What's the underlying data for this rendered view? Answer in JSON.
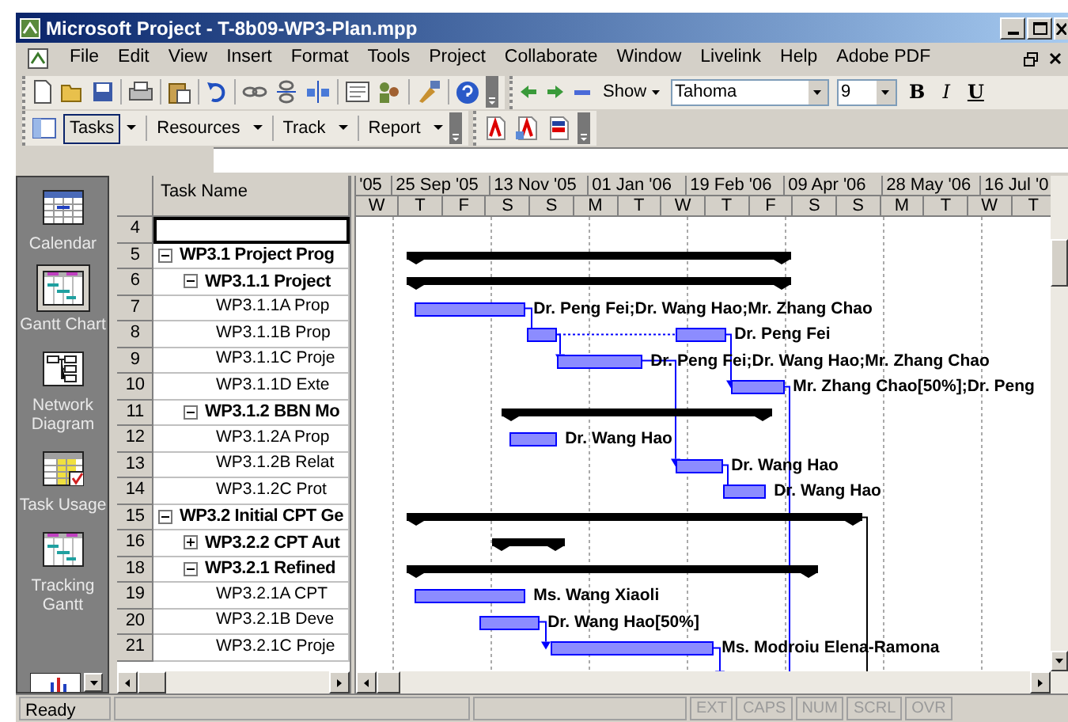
{
  "window": {
    "title": "Microsoft Project - T-8b09-WP3-Plan.mpp"
  },
  "menu": [
    "File",
    "Edit",
    "View",
    "Insert",
    "Format",
    "Tools",
    "Project",
    "Collaborate",
    "Window",
    "Livelink",
    "Help",
    "Adobe PDF"
  ],
  "formatting": {
    "show_label": "Show",
    "font": "Tahoma",
    "size": "9",
    "bold": "B",
    "italic": "I",
    "underline": "U"
  },
  "guide_toolbar": [
    {
      "label": "Tasks",
      "selected": true
    },
    {
      "label": "Resources",
      "selected": false
    },
    {
      "label": "Track",
      "selected": false
    },
    {
      "label": "Report",
      "selected": false
    }
  ],
  "view_bar": [
    {
      "label": "Calendar",
      "kind": "calendar",
      "selected": false
    },
    {
      "label": "Gantt Chart",
      "kind": "gantt",
      "selected": true
    },
    {
      "label": "Network Diagram",
      "kind": "network",
      "selected": false
    },
    {
      "label": "Task Usage",
      "kind": "usage",
      "selected": false
    },
    {
      "label": "Tracking Gantt",
      "kind": "gantt",
      "selected": false
    }
  ],
  "table": {
    "column": "Task Name"
  },
  "tasks": [
    {
      "id": "4",
      "kind": "blank",
      "selected": true
    },
    {
      "id": "5",
      "name": "WP3.1 Project Prog",
      "kind": "summary",
      "expanded": true,
      "selected": false,
      "children": [
        {
          "id": "6",
          "name": "WP3.1.1 Project",
          "kind": "summary",
          "expanded": true,
          "selected": false,
          "children": [
            {
              "id": "7",
              "name": "WP3.1.1A Prop",
              "kind": "task",
              "selected": false,
              "resources": "Dr. Peng Fei;Dr. Wang Hao;Mr. Zhang Chao"
            },
            {
              "id": "8",
              "name": "WP3.1.1B Prop",
              "kind": "task",
              "selected": false,
              "resources": "Dr. Peng Fei"
            },
            {
              "id": "9",
              "name": "WP3.1.1C Proje",
              "kind": "task",
              "selected": false,
              "resources": "Dr. Peng Fei;Dr. Wang Hao;Mr. Zhang Chao"
            },
            {
              "id": "10",
              "name": "WP3.1.1D Exte",
              "kind": "task",
              "selected": false,
              "resources": "Mr. Zhang Chao[50%];Dr. Peng"
            }
          ]
        },
        {
          "id": "11",
          "name": "WP3.1.2 BBN Mo",
          "kind": "summary",
          "expanded": true,
          "selected": false,
          "children": [
            {
              "id": "12",
              "name": "WP3.1.2A Prop",
              "kind": "task",
              "selected": false,
              "resources": "Dr. Wang Hao"
            },
            {
              "id": "13",
              "name": "WP3.1.2B Relat",
              "kind": "task",
              "selected": false,
              "resources": "Dr. Wang Hao"
            },
            {
              "id": "14",
              "name": "WP3.1.2C Prot",
              "kind": "task",
              "selected": false,
              "resources": "Dr. Wang Hao"
            }
          ]
        }
      ]
    },
    {
      "id": "15",
      "name": "WP3.2 Initial CPT Ge",
      "kind": "summary",
      "expanded": true,
      "selected": false,
      "children": [
        {
          "id": "16",
          "name": "WP3.2.2 CPT Aut",
          "kind": "summary",
          "expanded": false,
          "selected": false
        },
        {
          "id": "18",
          "name": "WP3.2.1 Refined",
          "kind": "summary",
          "expanded": true,
          "selected": false,
          "children": [
            {
              "id": "19",
              "name": "WP3.2.1A CPT",
              "kind": "task",
              "selected": false,
              "resources": "Ms. Wang Xiaoli"
            },
            {
              "id": "20",
              "name": "WP3.2.1B Deve",
              "kind": "task",
              "selected": false,
              "resources": "Dr. Wang Hao[50%]"
            },
            {
              "id": "21",
              "name": "WP3.2.1C Proje",
              "kind": "task",
              "selected": false,
              "resources": "Ms. Modroiu Elena-Ramona"
            }
          ]
        }
      ]
    }
  ],
  "timescale": {
    "major": [
      "'05",
      "25 Sep '05",
      "13 Nov '05",
      "01 Jan '06",
      "19 Feb '06",
      "09 Apr '06",
      "28 May '06",
      "16 Jul '0"
    ],
    "minor": [
      "W",
      "T",
      "F",
      "S",
      "S",
      "M",
      "T",
      "W",
      "T",
      "F",
      "S",
      "S",
      "M",
      "T",
      "W",
      "T"
    ]
  },
  "status_bar": {
    "text": "Ready",
    "indicators": [
      {
        "label": "EXT",
        "on": false
      },
      {
        "label": "CAPS",
        "on": false
      },
      {
        "label": "NUM",
        "on": false
      },
      {
        "label": "SCRL",
        "on": false
      },
      {
        "label": "OVR",
        "on": false
      }
    ]
  }
}
